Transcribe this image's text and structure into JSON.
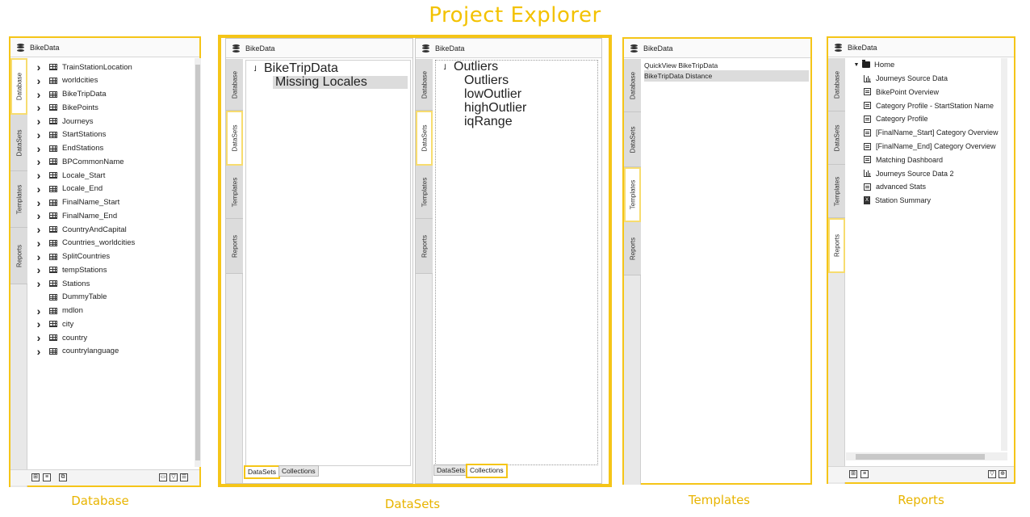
{
  "page": {
    "title": "Project Explorer"
  },
  "captions": {
    "database": "Database",
    "datasets": "DataSets",
    "templates": "Templates",
    "reports": "Reports"
  },
  "tabs": {
    "database": "Database",
    "datasets": "DataSets",
    "templates": "Templates",
    "reports": "Reports"
  },
  "header_title": "BikeData",
  "database_panel": {
    "items": [
      {
        "label": "TrainStationLocation",
        "expandable": true
      },
      {
        "label": "worldcities",
        "expandable": true
      },
      {
        "label": "BikeTripData",
        "expandable": true
      },
      {
        "label": "BikePoints",
        "expandable": true
      },
      {
        "label": "Journeys",
        "expandable": true
      },
      {
        "label": "StartStations",
        "expandable": true
      },
      {
        "label": "EndStations",
        "expandable": true
      },
      {
        "label": "BPCommonName",
        "expandable": true
      },
      {
        "label": "Locale_Start",
        "expandable": true
      },
      {
        "label": "Locale_End",
        "expandable": true
      },
      {
        "label": "FinalName_Start",
        "expandable": true
      },
      {
        "label": "FinalName_End",
        "expandable": true
      },
      {
        "label": "CountryAndCapital",
        "expandable": true
      },
      {
        "label": "Countries_worldcities",
        "expandable": true
      },
      {
        "label": "SplitCountries",
        "expandable": true
      },
      {
        "label": "tempStations",
        "expandable": true
      },
      {
        "label": "Stations",
        "expandable": true
      },
      {
        "label": "DummyTable",
        "expandable": false
      },
      {
        "label": "mdlon",
        "expandable": true
      },
      {
        "label": "city",
        "expandable": true
      },
      {
        "label": "country",
        "expandable": true
      },
      {
        "label": "countrylanguage",
        "expandable": true
      }
    ]
  },
  "datasets_panel_a": {
    "root": "BikeTripData",
    "children": [
      "Missing Locales"
    ],
    "bottom_tabs": [
      "DataSets",
      "Collections"
    ],
    "active_bottom_tab": "DataSets"
  },
  "datasets_panel_b": {
    "root": "Outliers",
    "children": [
      "Outliers",
      "lowOutlier",
      "highOutlier",
      "iqRange"
    ],
    "bottom_tabs": [
      "DataSets",
      "Collections"
    ],
    "active_bottom_tab": "Collections"
  },
  "templates_panel": {
    "items": [
      "QuickView BikeTripData",
      "BikeTripData Distance"
    ]
  },
  "reports_panel": {
    "folder": "Home",
    "items": [
      {
        "label": "Journeys Source Data",
        "icon": "bar-chart-icon"
      },
      {
        "label": "BikePoint Overview",
        "icon": "report-icon"
      },
      {
        "label": "Category Profile - StartStation Name",
        "icon": "report-icon"
      },
      {
        "label": "Category Profile",
        "icon": "report-icon"
      },
      {
        "label": "[FinalName_Start] Category Overview",
        "icon": "report-icon"
      },
      {
        "label": "[FinalName_End] Category Overview",
        "icon": "report-icon"
      },
      {
        "label": "Matching Dashboard",
        "icon": "report-icon"
      },
      {
        "label": "Journeys Source Data 2",
        "icon": "bar-chart-icon"
      },
      {
        "label": "advanced Stats",
        "icon": "report-icon"
      },
      {
        "label": "Station Summary",
        "icon": "excel-icon"
      }
    ]
  },
  "colors": {
    "accent": "#f5c518",
    "caption": "#e8b400"
  }
}
